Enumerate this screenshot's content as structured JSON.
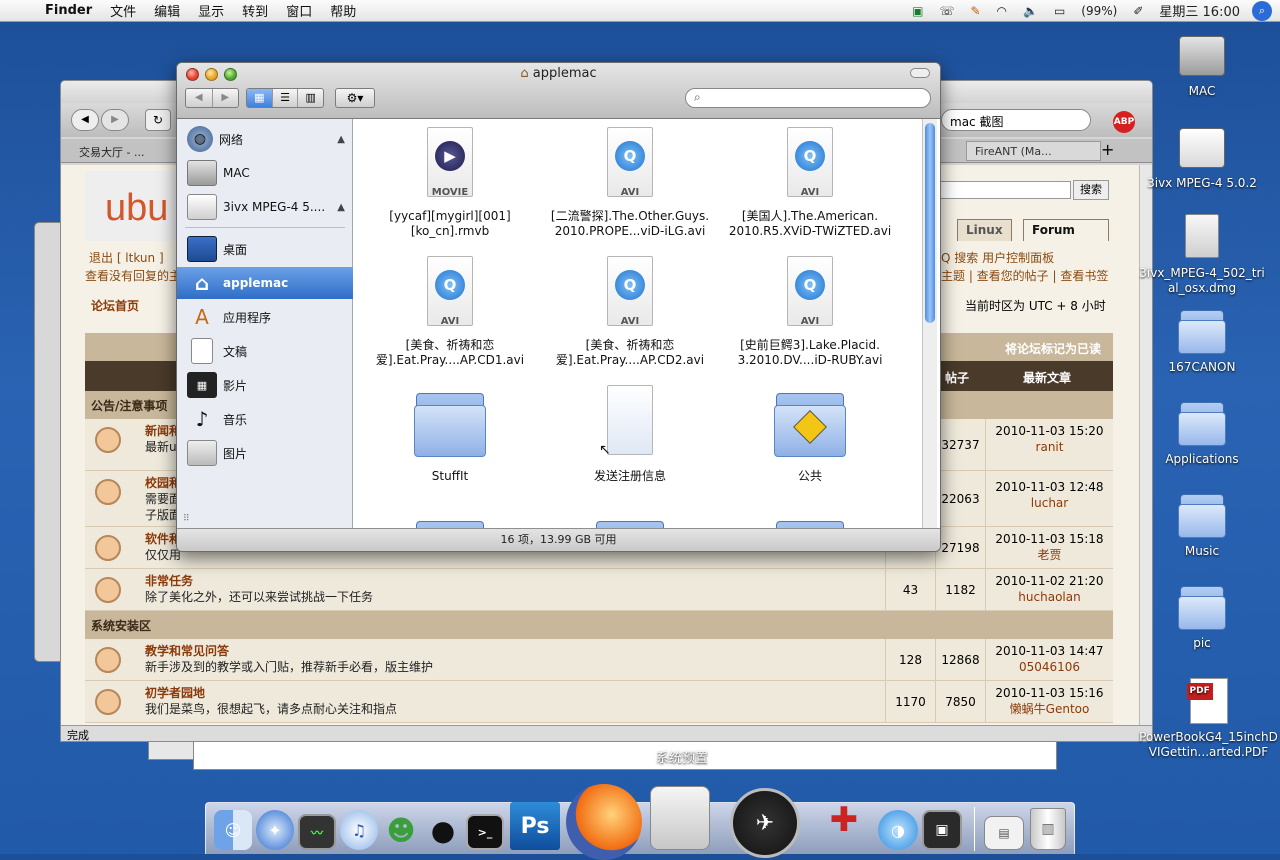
{
  "menubar": {
    "app": "Finder",
    "items": [
      "文件",
      "编辑",
      "显示",
      "转到",
      "窗口",
      "帮助"
    ],
    "battery": "(99%)",
    "clock": "星期三 16:00"
  },
  "browser": {
    "search_value": "mac 截图",
    "tab1": "交易大厅 - ...",
    "tab2": "FireANT (Ma...",
    "status": "完成",
    "forum": {
      "logo": "ubu",
      "search_button": "搜索",
      "tabs": [
        "Linux",
        "Forum"
      ],
      "links_left1": "退出 [ ltkun ]",
      "links_left2": "查看没有回复的主",
      "links_right1": "Q  搜索  用户控制面板",
      "links_right2": "主题 | 查看您的帖子 | 查看书签",
      "home": "论坛首页",
      "timezone": "当前时区为 UTC + 8 小时",
      "mark_read": "将论坛标记为已读",
      "col_posts": "帖子",
      "col_last": "最新文章",
      "section1": "公告/注意事项",
      "section2": "系统安装区",
      "rows": [
        {
          "title": "新闻和",
          "desc": "最新u",
          "topics": "",
          "posts": "32737",
          "date": "2010-11-03 15:20",
          "user": "ranit"
        },
        {
          "title": "校园和",
          "desc": "需要面",
          "desc2": "子版面",
          "topics": "",
          "posts": "22063",
          "date": "2010-11-03 12:48",
          "user": "luchar"
        },
        {
          "title": "软件和",
          "desc": "仅仅用",
          "topics": "",
          "posts": "27198",
          "date": "2010-11-03 15:18",
          "user": "老贾"
        },
        {
          "title": "非常任务",
          "desc": "除了美化之外，还可以来尝试挑战一下任务",
          "topics": "43",
          "posts": "1182",
          "date": "2010-11-02 21:20",
          "user": "huchaolan"
        },
        {
          "title": "教学和常见问答",
          "desc": "新手涉及到的教学或入门贴，推荐新手必看，版主维护",
          "topics": "128",
          "posts": "12868",
          "date": "2010-11-03 14:47",
          "user": "05046106"
        },
        {
          "title": "初学者园地",
          "desc": "我们是菜鸟，很想起飞，请多点耐心关注和指点",
          "topics": "1170",
          "posts": "7850",
          "date": "2010-11-03 15:16",
          "user": "懒蜗牛Gentoo"
        }
      ]
    }
  },
  "finder": {
    "title": "applemac",
    "sidebar": [
      {
        "label": "网络",
        "icon": "globe-icon",
        "eject": "▲"
      },
      {
        "label": "MAC",
        "icon": "hard-drive-icon"
      },
      {
        "label": "3ivx MPEG-4 5....",
        "icon": "disk-image-icon",
        "eject": "▲"
      },
      {
        "label": "桌面",
        "icon": "desktop-icon"
      },
      {
        "label": "applemac",
        "icon": "home-icon"
      },
      {
        "label": "应用程序",
        "icon": "applications-icon"
      },
      {
        "label": "文稿",
        "icon": "documents-icon"
      },
      {
        "label": "影片",
        "icon": "movies-icon"
      },
      {
        "label": "音乐",
        "icon": "music-icon"
      },
      {
        "label": "图片",
        "icon": "pictures-icon"
      }
    ],
    "items": [
      {
        "name": "[yycaf][mygirl][001]\n[ko_cn].rmvb",
        "badge": "MOVIE",
        "kind": "movie"
      },
      {
        "name": "[二流警探].The.Other.Guys.\n2010.PROPE...viD-iLG.avi",
        "badge": "AVI",
        "kind": "avi"
      },
      {
        "name": "[美国人].The.American.\n2010.R5.XViD-TWiZTED.avi",
        "badge": "AVI",
        "kind": "avi"
      },
      {
        "name": "[美食、祈祷和恋\n爱].Eat.Pray....AP.CD1.avi",
        "badge": "AVI",
        "kind": "avi"
      },
      {
        "name": "[美食、祈祷和恋\n爱].Eat.Pray....AP.CD2.avi",
        "badge": "AVI",
        "kind": "avi"
      },
      {
        "name": "[史前巨鳄3].Lake.Placid.\n3.2010.DV....iD-RUBY.avi",
        "badge": "AVI",
        "kind": "avi"
      },
      {
        "name": "StuffIt",
        "badge": "",
        "kind": "folder"
      },
      {
        "name": "发送注册信息",
        "badge": "",
        "kind": "alias"
      },
      {
        "name": "公共",
        "badge": "",
        "kind": "public"
      }
    ],
    "status": "16 项，13.99 GB 可用"
  },
  "desktop": [
    {
      "label": "MAC",
      "kind": "hd"
    },
    {
      "label": "3ivx MPEG-4 5.0.2",
      "kind": "removable"
    },
    {
      "label": "3ivx_MPEG-4_502_trial_osx.dmg",
      "kind": "dmg"
    },
    {
      "label": "167CANON",
      "kind": "folder"
    },
    {
      "label": "Applications",
      "kind": "folder"
    },
    {
      "label": "Music",
      "kind": "folder"
    },
    {
      "label": "pic",
      "kind": "folder"
    },
    {
      "label": "PowerBookG4_15inchDVIGettin...arted.PDF",
      "kind": "pdf"
    }
  ],
  "dock": {
    "tooltip": "系统预置",
    "apps": [
      "Finder",
      "Safari",
      "活动监视器",
      "iTunes",
      "Messenger",
      "QQ",
      "终端",
      "Photoshop",
      "Firefox",
      "系统预置",
      "Dashboard",
      "Automator",
      "Messenger Blue",
      "Photo Booth",
      "Preview",
      "废纸篓"
    ]
  }
}
